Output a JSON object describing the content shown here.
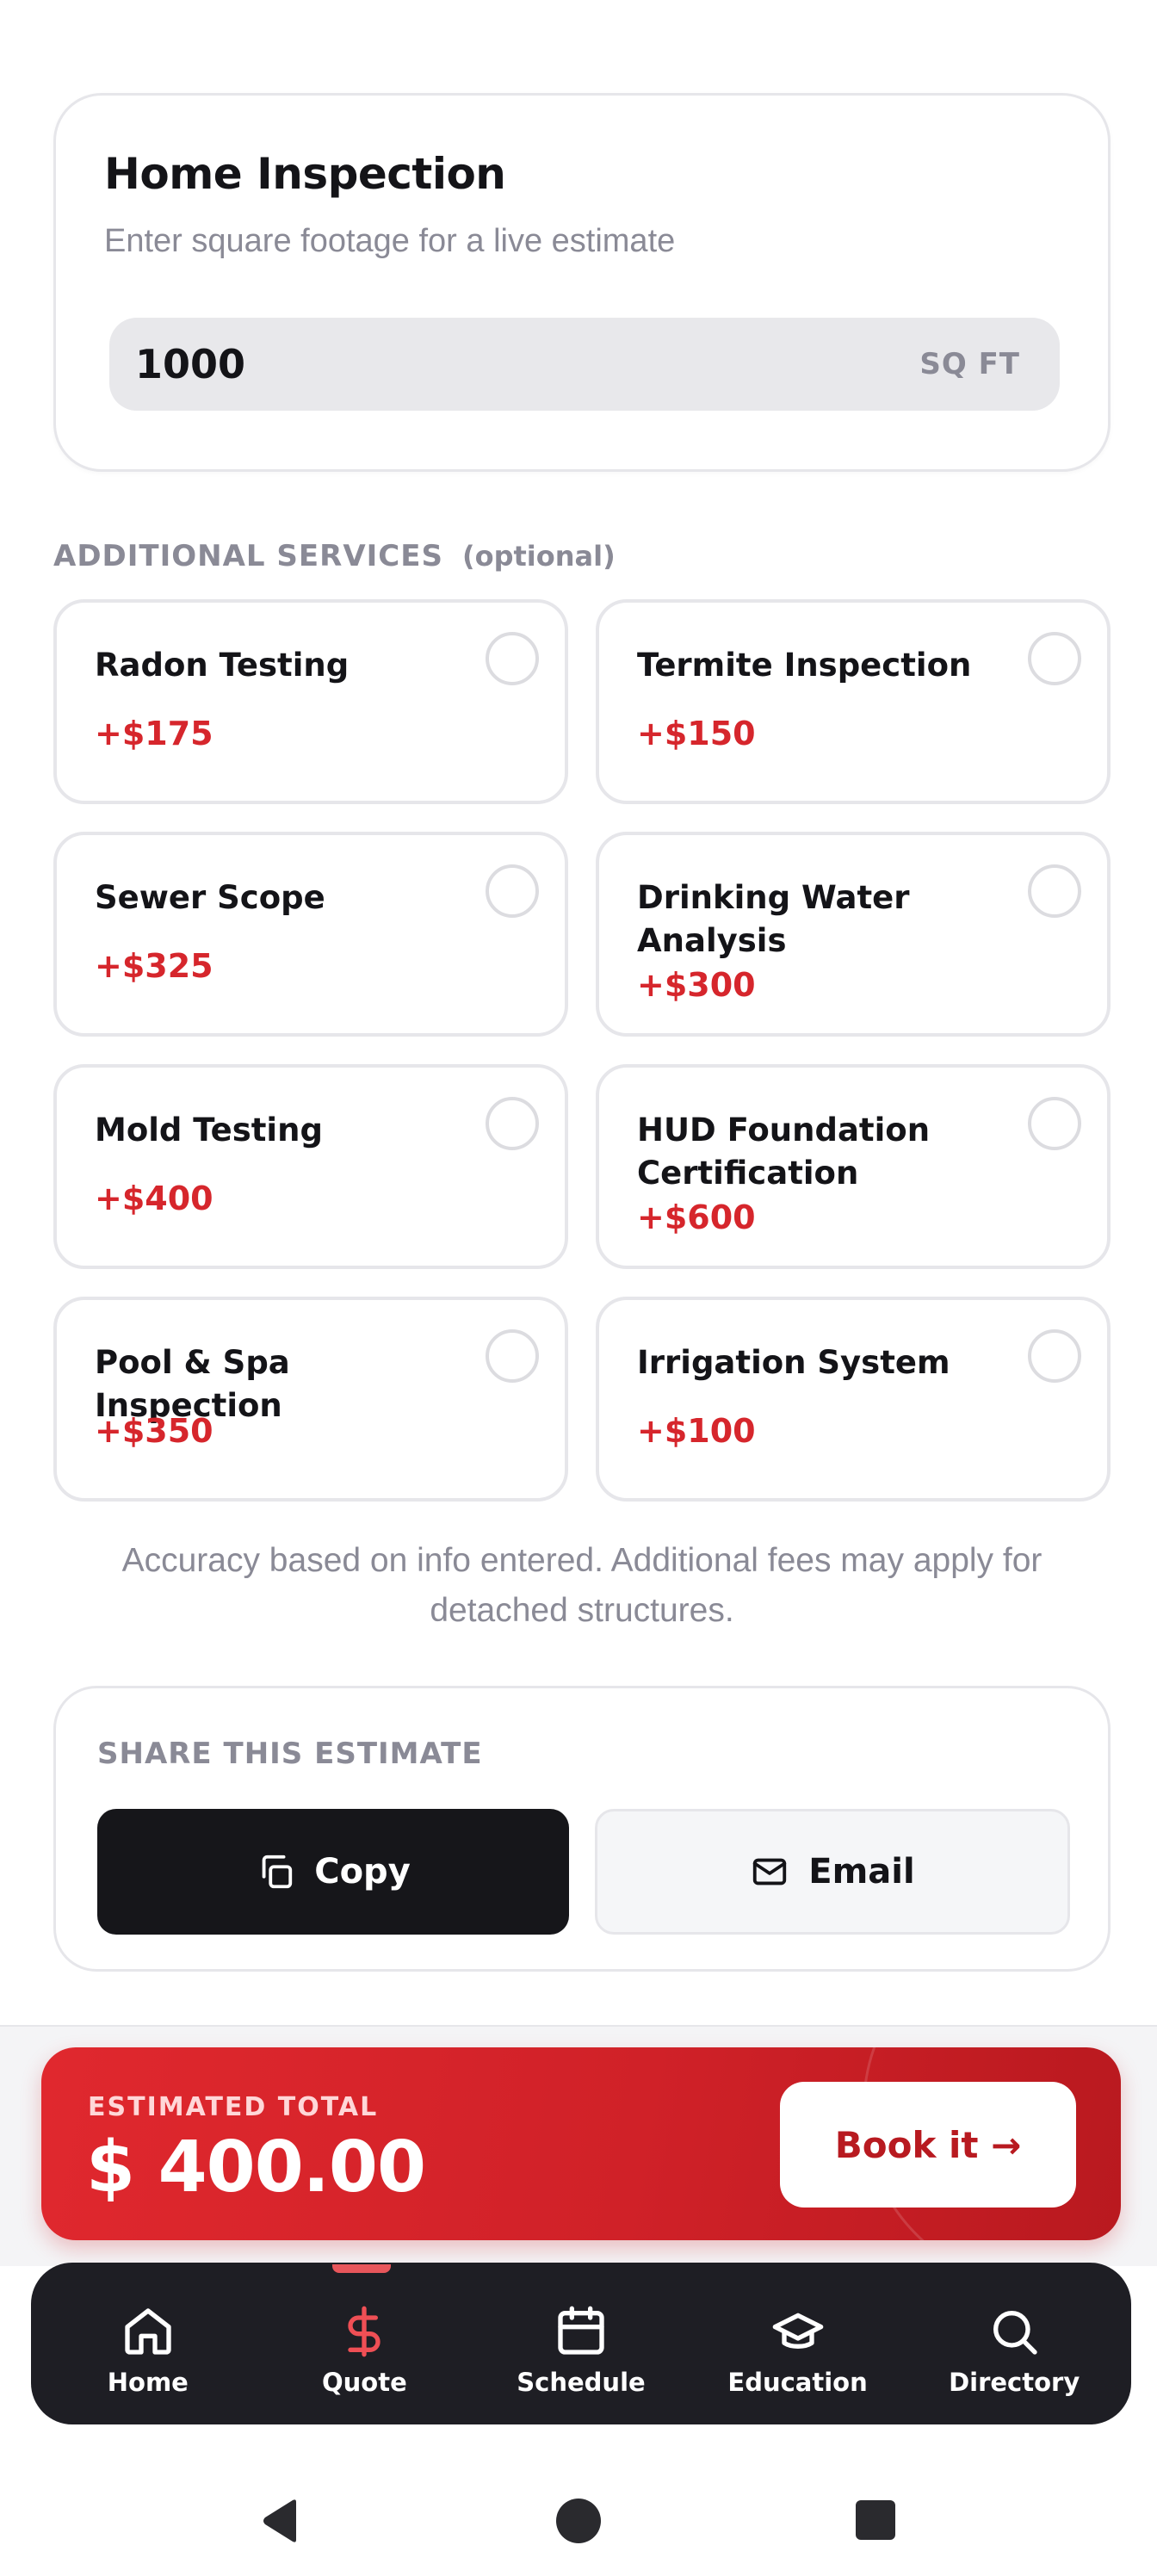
{
  "inspection": {
    "title": "Home Inspection",
    "subtitle": "Enter square footage for a live estimate",
    "sqft_value": "1000",
    "sqft_unit": "SQ FT"
  },
  "services": {
    "title": "ADDITIONAL SERVICES",
    "optional_label": "(optional)",
    "items": [
      {
        "name": "Radon Testing",
        "price": "+$175"
      },
      {
        "name": "Termite Inspection",
        "price": "+$150"
      },
      {
        "name": "Sewer Scope",
        "price": "+$325"
      },
      {
        "name": "Drinking Water Analysis",
        "price": "+$300"
      },
      {
        "name": "Mold Testing",
        "price": "+$400"
      },
      {
        "name": "HUD Foundation Certification",
        "price": "+$600"
      },
      {
        "name": "Pool & Spa Inspection",
        "price": "+$350"
      },
      {
        "name": "Irrigation System",
        "price": "+$100"
      }
    ]
  },
  "disclaimer": "Accuracy based on info entered. Additional fees may apply for detached structures.",
  "share": {
    "title": "SHARE THIS ESTIMATE",
    "copy_label": "Copy",
    "email_label": "Email"
  },
  "total": {
    "label": "ESTIMATED TOTAL",
    "amount": "$ 400.00",
    "book_label": "Book it →"
  },
  "nav": {
    "items": [
      {
        "label": "Home",
        "icon": "home-icon"
      },
      {
        "label": "Quote",
        "icon": "dollar-icon",
        "active": true
      },
      {
        "label": "Schedule",
        "icon": "calendar-icon"
      },
      {
        "label": "Education",
        "icon": "graduation-cap-icon"
      },
      {
        "label": "Directory",
        "icon": "search-icon"
      }
    ]
  },
  "colors": {
    "accent": "#d6262c",
    "nav_bg": "#1e1e24",
    "muted": "#8a8a96"
  }
}
